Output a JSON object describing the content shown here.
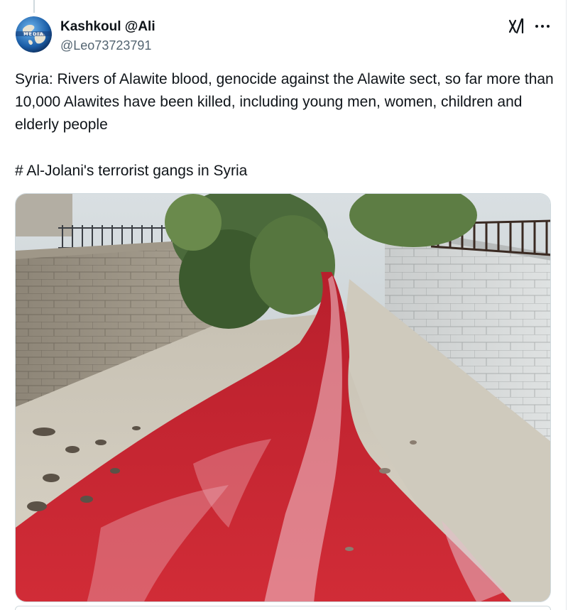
{
  "post": {
    "author": {
      "display_name": "Kashkoul @Ali",
      "handle": "@Leo73723791",
      "avatar_icon": "globe-avatar-icon",
      "avatar_text": "MEDIA"
    },
    "actions": {
      "grok_icon": "grok-icon",
      "more_icon": "more-options-icon"
    },
    "text": "Syria: Rivers of Alawite blood, genocide against the Alawite sect, so far more than 10,000 Alawites have been killed, including young men, women, children and elderly people",
    "hashtag_line": "# Al-Jolani's terrorist gangs in Syria",
    "media": {
      "type": "photo",
      "subject": "canal-with-red-water"
    }
  },
  "colors": {
    "text_primary": "#0f1419",
    "text_secondary": "#536471",
    "border": "#cfd9de",
    "red_water": "#c0272f"
  }
}
